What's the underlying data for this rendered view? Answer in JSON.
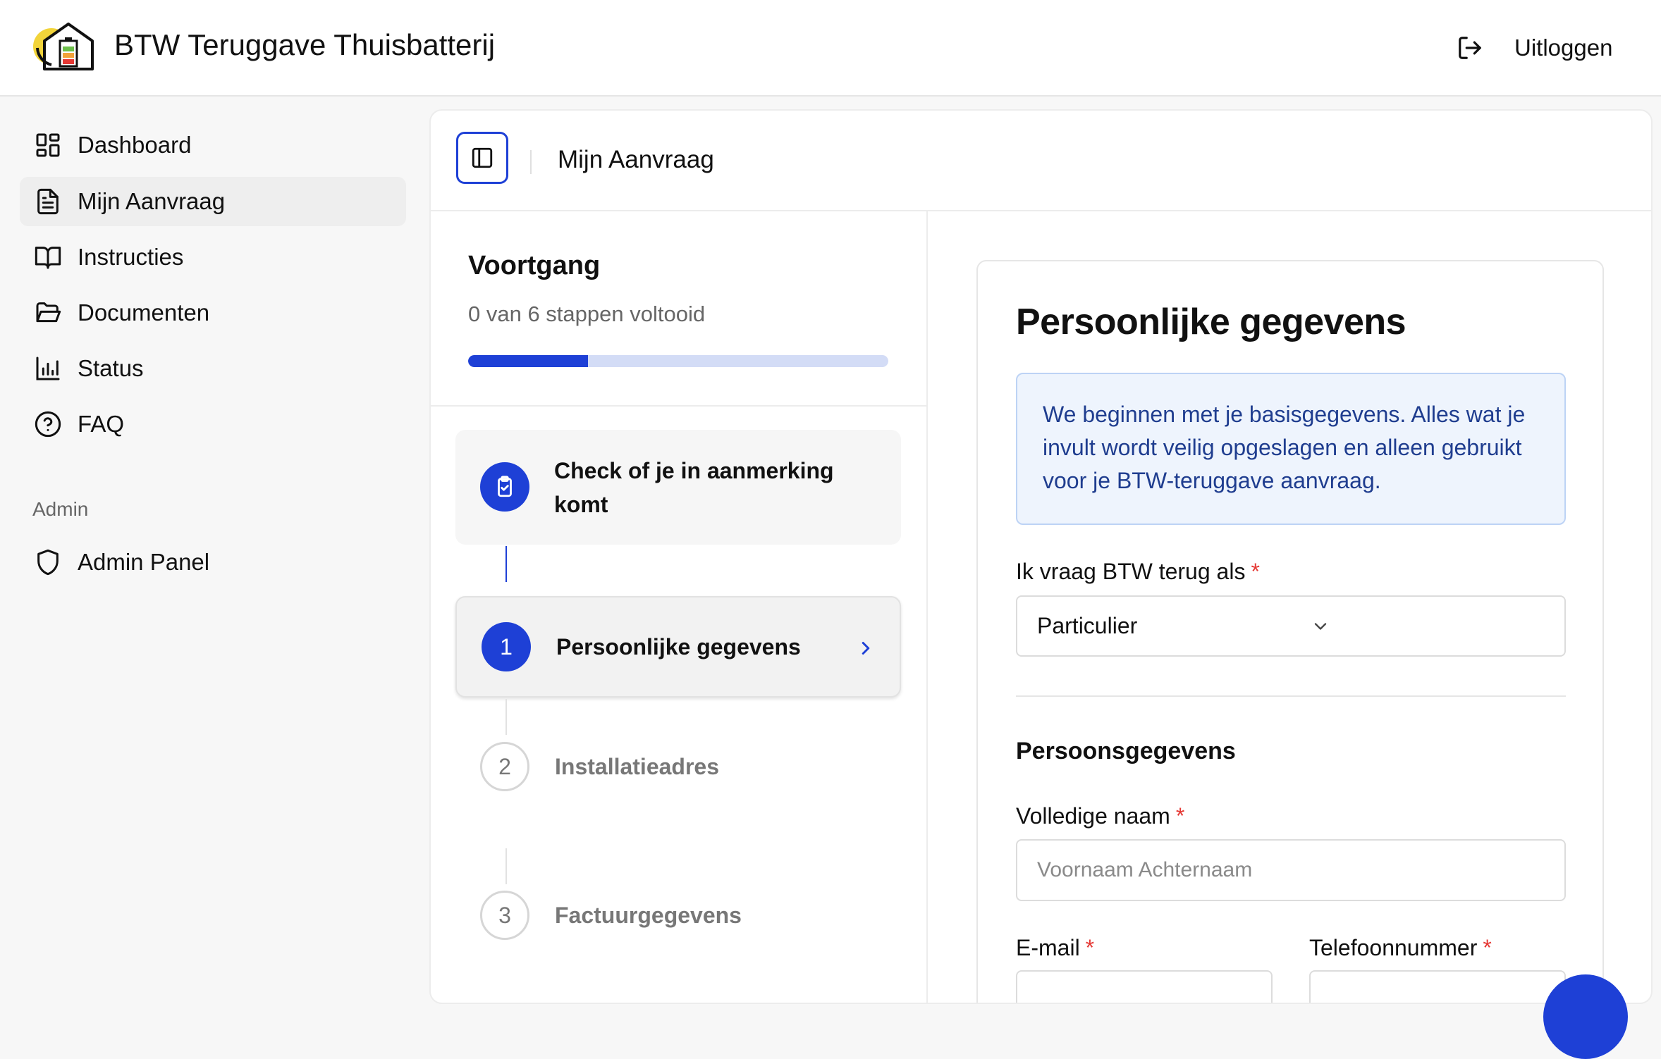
{
  "app": {
    "title": "BTW Teruggave Thuisbatterij",
    "logout_label": "Uitloggen"
  },
  "sidebar": {
    "items": [
      {
        "label": "Dashboard",
        "icon": "dashboard-icon"
      },
      {
        "label": "Mijn Aanvraag",
        "icon": "document-icon",
        "active": true
      },
      {
        "label": "Instructies",
        "icon": "book-icon"
      },
      {
        "label": "Documenten",
        "icon": "folder-icon"
      },
      {
        "label": "Status",
        "icon": "bar-chart-icon"
      },
      {
        "label": "FAQ",
        "icon": "help-circle-icon"
      }
    ],
    "admin_heading": "Admin",
    "admin_item": {
      "label": "Admin Panel",
      "icon": "shield-icon"
    }
  },
  "header": {
    "title": "Mijn Aanvraag"
  },
  "progress": {
    "title": "Voortgang",
    "subtitle": "0 van 6 stappen voltooid",
    "fill_fraction": 0.285
  },
  "steps": [
    {
      "label": "Check of je in aanmerking komt",
      "icon": "clipboard-check-icon",
      "state": "current-intro"
    },
    {
      "number": "1",
      "label": "Persoonlijke gegevens",
      "state": "active"
    },
    {
      "number": "2",
      "label": "Installatieadres",
      "state": "pending"
    },
    {
      "number": "3",
      "label": "Factuurgegevens",
      "state": "pending"
    }
  ],
  "form": {
    "title": "Persoonlijke gegevens",
    "info": "We beginnen met je basisgegevens. Alles wat je invult wordt veilig opgeslagen en alleen gebruikt voor je BTW-teruggave aanvraag.",
    "role_label": "Ik vraag BTW terug als",
    "role_value": "Particulier",
    "required_mark": "*",
    "section_heading": "Persoonsgegevens",
    "name_label": "Volledige naam",
    "name_placeholder": "Voornaam Achternaam",
    "email_label": "E-mail",
    "phone_label": "Telefoonnummer"
  },
  "colors": {
    "accent": "#1e40d6",
    "required": "#e53935",
    "info_bg": "#eef4fd",
    "info_text": "#1f3d8f"
  }
}
